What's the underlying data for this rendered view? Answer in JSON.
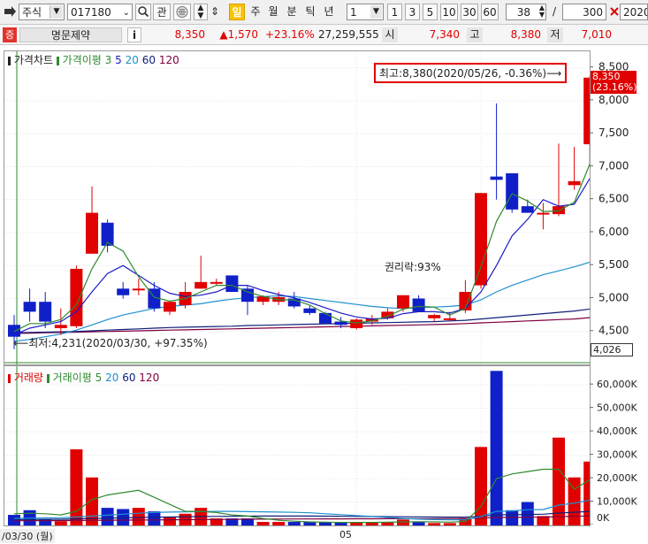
{
  "toolbar": {
    "market": "주식",
    "code": "017180",
    "watch_label": "관",
    "period_active": "일",
    "periods": [
      "주",
      "월",
      "분",
      "틱",
      "년"
    ],
    "unit_select": "1",
    "quick_counts": [
      "1",
      "3",
      "5",
      "10",
      "30",
      "60"
    ],
    "view_count": "38",
    "slash": "/",
    "total_count": "300",
    "date": "2020/"
  },
  "quote": {
    "badge": "증",
    "name": "명문제약",
    "info": "i",
    "price": "8,350",
    "change": "▲1,570",
    "change_rate": "+23.16%",
    "volume": "27,259,555",
    "open_label": "시",
    "open": "7,340",
    "high_label": "고",
    "high": "8,380",
    "low_label": "저",
    "low": "7,010"
  },
  "colors": {
    "up": "#e10000",
    "down": "#1020c8",
    "ma3": "#2f8a2f",
    "ma5": "#1c1cc8",
    "ma20": "#1e90d0",
    "ma60": "#10207a",
    "ma120": "#800040"
  },
  "price_panel": {
    "legend_title": "가격차트",
    "legend_ma_label": "가격이평",
    "legend_periods": [
      "3",
      "5",
      "20",
      "60",
      "120"
    ],
    "annotation_high": "최고:8,380(2020/05/26, -0.36%)",
    "annotation_low": "최저:4,231(2020/03/30, +97.35%)",
    "annotation_rights": "권리락:93%",
    "current_price_label": "8,350",
    "current_rate_label": "(23.16%)",
    "crosshair_label": "4,026"
  },
  "volume_panel": {
    "legend_title": "거래량",
    "legend_ma_label": "거래이평",
    "legend_periods": [
      "5",
      "20",
      "60",
      "120"
    ]
  },
  "x_axis": {
    "start_label": "/03/30 (월)",
    "month_label": "05"
  },
  "chart_data": [
    {
      "type": "candlestick",
      "title": "가격차트",
      "ylim": [
        4000,
        8750
      ],
      "y_ticks": [
        "4,500",
        "5,000",
        "5,500",
        "6,000",
        "6,500",
        "7,000",
        "7,500",
        "8,000",
        "8,500"
      ],
      "y_tick_values": [
        4500,
        5000,
        5500,
        6000,
        6500,
        7000,
        7500,
        8000,
        8500
      ],
      "ohlc": [
        [
          4600,
          4750,
          4231,
          4420
        ],
        [
          4950,
          5150,
          4650,
          4800
        ],
        [
          4950,
          5100,
          4550,
          4650
        ],
        [
          4550,
          4850,
          4450,
          4600
        ],
        [
          4580,
          5500,
          4550,
          5450
        ],
        [
          5680,
          6700,
          5680,
          6300
        ],
        [
          6150,
          6200,
          5700,
          5800
        ],
        [
          5150,
          5250,
          5000,
          5050
        ],
        [
          5150,
          5300,
          5050,
          5150
        ],
        [
          5150,
          5250,
          4800,
          4850
        ],
        [
          4800,
          4950,
          4750,
          4950
        ],
        [
          4900,
          5250,
          4850,
          5100
        ],
        [
          5150,
          5650,
          5150,
          5250
        ],
        [
          5250,
          5300,
          5200,
          5250
        ],
        [
          5350,
          5350,
          5100,
          5100
        ],
        [
          5150,
          5200,
          4750,
          4950
        ],
        [
          4950,
          5050,
          4900,
          5030
        ],
        [
          4950,
          5100,
          4900,
          5020
        ],
        [
          5000,
          5100,
          4850,
          4880
        ],
        [
          4850,
          4900,
          4750,
          4780
        ],
        [
          4780,
          4800,
          4650,
          4620
        ],
        [
          4650,
          4720,
          4550,
          4600
        ],
        [
          4550,
          4700,
          4530,
          4680
        ],
        [
          4650,
          4750,
          4600,
          4700
        ],
        [
          4700,
          4850,
          4680,
          4800
        ],
        [
          4850,
          5050,
          4800,
          5050
        ],
        [
          5000,
          5050,
          4850,
          4800
        ],
        [
          4700,
          4770,
          4650,
          4750
        ],
        [
          4700,
          4800,
          4650,
          4700
        ],
        [
          4820,
          5280,
          4780,
          5100
        ],
        [
          5200,
          6600,
          5150,
          6600
        ],
        [
          6850,
          7960,
          6500,
          6800
        ],
        [
          6900,
          6900,
          6300,
          6350
        ],
        [
          6400,
          6500,
          6300,
          6300
        ],
        [
          6300,
          6450,
          6050,
          6300
        ],
        [
          6280,
          7350,
          6250,
          6400
        ],
        [
          6720,
          7300,
          6650,
          6780
        ],
        [
          7340,
          8380,
          7010,
          8350
        ]
      ],
      "ma3": [
        4500,
        4620,
        4620,
        4680,
        4900,
        5450,
        5850,
        5720,
        5330,
        5020,
        4960,
        5000,
        5100,
        5200,
        5200,
        5100,
        5030,
        4980,
        4980,
        4900,
        4770,
        4660,
        4630,
        4660,
        4730,
        4840,
        4880,
        4870,
        4750,
        4850,
        5480,
        6170,
        6590,
        6480,
        6320,
        6330,
        6460,
        7040
      ],
      "ma5": [
        4450,
        4550,
        4600,
        4650,
        4800,
        5100,
        5380,
        5500,
        5350,
        5200,
        5080,
        5030,
        5050,
        5100,
        5200,
        5200,
        5120,
        5060,
        5010,
        4940,
        4860,
        4780,
        4720,
        4690,
        4700,
        4770,
        4800,
        4800,
        4780,
        4850,
        5100,
        5500,
        5950,
        6200,
        6500,
        6400,
        6430,
        6820
      ],
      "ma20": [
        4350,
        4380,
        4420,
        4460,
        4520,
        4600,
        4680,
        4750,
        4800,
        4850,
        4880,
        4900,
        4920,
        4960,
        4990,
        5010,
        5030,
        5040,
        5030,
        5000,
        4970,
        4940,
        4910,
        4880,
        4860,
        4850,
        4860,
        4870,
        4880,
        4900,
        4980,
        5100,
        5200,
        5280,
        5360,
        5420,
        5480,
        5550
      ],
      "ma60": [
        4480,
        4485,
        4490,
        4495,
        4500,
        4510,
        4520,
        4530,
        4540,
        4550,
        4560,
        4565,
        4570,
        4575,
        4580,
        4590,
        4595,
        4600,
        4605,
        4610,
        4615,
        4620,
        4625,
        4630,
        4635,
        4640,
        4645,
        4650,
        4660,
        4670,
        4690,
        4710,
        4730,
        4750,
        4770,
        4790,
        4810,
        4840
      ],
      "ma120": [
        4470,
        4475,
        4480,
        4485,
        4490,
        4495,
        4500,
        4505,
        4510,
        4515,
        4520,
        4525,
        4530,
        4535,
        4540,
        4545,
        4550,
        4555,
        4560,
        4565,
        4570,
        4575,
        4580,
        4585,
        4590,
        4595,
        4600,
        4605,
        4610,
        4620,
        4630,
        4640,
        4650,
        4660,
        4670,
        4680,
        4690,
        4710
      ]
    },
    {
      "type": "bar",
      "title": "거래량",
      "ylim": [
        0,
        68000
      ],
      "y_ticks": [
        "0K",
        "10,000K",
        "20,000K",
        "30,000K",
        "40,000K",
        "50,000K",
        "60,000K"
      ],
      "y_tick_values": [
        0,
        10000,
        20000,
        30000,
        40000,
        50000,
        60000
      ],
      "values": [
        4500,
        6500,
        2500,
        1800,
        32500,
        20500,
        7500,
        7000,
        7500,
        6000,
        3500,
        5000,
        7500,
        3000,
        3000,
        3000,
        1500,
        1500,
        1500,
        1500,
        1500,
        1200,
        1200,
        1200,
        1500,
        2500,
        1500,
        1000,
        1000,
        3000,
        33500,
        66000,
        6500,
        10000,
        4000,
        37500,
        20500,
        27259
      ],
      "ma5": [
        5000,
        5200,
        5000,
        4500,
        6000,
        11000,
        13000,
        14000,
        15000,
        12000,
        9000,
        6000,
        6000,
        5500,
        4500,
        4000,
        3000,
        2200,
        1800,
        1500,
        1400,
        1300,
        1300,
        1300,
        1400,
        1500,
        1600,
        1500,
        1400,
        1700,
        8000,
        20000,
        22000,
        23000,
        24000,
        24000,
        15500,
        19500
      ],
      "ma20": [
        3000,
        3100,
        3200,
        3300,
        3600,
        4000,
        4400,
        4800,
        5200,
        5500,
        5700,
        5800,
        5900,
        6000,
        6000,
        5900,
        5800,
        5700,
        5600,
        5400,
        5000,
        4600,
        4200,
        3800,
        3400,
        3000,
        2700,
        2500,
        2400,
        2400,
        3800,
        6000,
        6200,
        6700,
        6800,
        8700,
        9500,
        10800
      ],
      "ma60": [
        2500,
        2550,
        2600,
        2650,
        2800,
        2950,
        3100,
        3250,
        3400,
        3500,
        3600,
        3700,
        3800,
        3850,
        3900,
        3950,
        4000,
        4000,
        4000,
        4000,
        3950,
        3900,
        3850,
        3800,
        3750,
        3700,
        3650,
        3600,
        3550,
        3550,
        3900,
        4500,
        4600,
        4700,
        4800,
        5300,
        5600,
        6000
      ],
      "ma120": [
        2000,
        2020,
        2040,
        2060,
        2100,
        2150,
        2200,
        2250,
        2300,
        2350,
        2400,
        2450,
        2500,
        2550,
        2600,
        2650,
        2700,
        2720,
        2740,
        2760,
        2780,
        2800,
        2820,
        2840,
        2860,
        2880,
        2900,
        2920,
        2940,
        2960,
        3100,
        3400,
        3450,
        3500,
        3550,
        3750,
        3900,
        4050
      ]
    }
  ]
}
